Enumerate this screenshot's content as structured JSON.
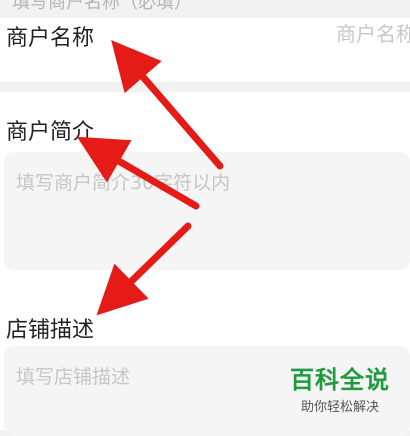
{
  "page": {
    "top_cut_text": "填写商户名称（必填）"
  },
  "form": {
    "merchant_name": {
      "label": "商户名称",
      "placeholder": "商户名称"
    },
    "merchant_intro": {
      "label": "商户简介",
      "placeholder": "填写商户简介30字符以内"
    },
    "store_description": {
      "label": "店铺描述",
      "placeholder": "填写店铺描述"
    }
  },
  "watermark": {
    "title": "百科全说",
    "subtitle": "助你轻松解决"
  },
  "annotations": {
    "arrow_color": "#e51b18"
  }
}
